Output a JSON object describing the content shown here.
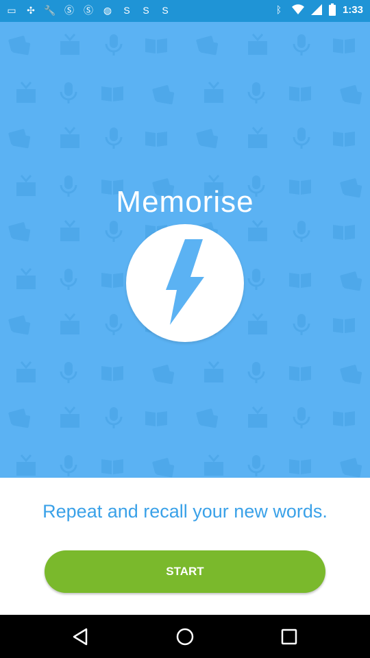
{
  "status_bar": {
    "time": "1:33",
    "left_icons": [
      "messages-icon",
      "pinwheel-icon",
      "wrench-icon",
      "sf-icon",
      "sf-icon",
      "yes-icon",
      "s-icon",
      "s-icon",
      "s-icon"
    ],
    "right_icons": [
      "bluetooth-icon",
      "wifi-icon",
      "signal-icon",
      "battery-icon"
    ]
  },
  "hero": {
    "title": "Memorise",
    "center_icon": "lightning-bolt-icon"
  },
  "main": {
    "tagline": "Repeat and recall your new words.",
    "start_label": "START"
  },
  "nav_bar": {
    "buttons": [
      "back-icon",
      "home-icon",
      "recent-apps-icon"
    ]
  },
  "colors": {
    "hero_background": "#5bb2f3",
    "tagline": "#3aa1e8",
    "start_button": "#7ab92c",
    "status_bar": "#1f94d6"
  }
}
